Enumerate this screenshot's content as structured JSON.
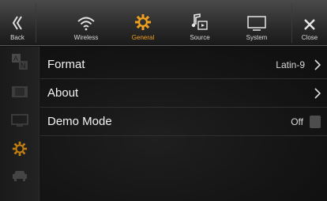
{
  "topbar": {
    "back_label": "Back",
    "close_label": "Close",
    "tabs": [
      {
        "label": "Wireless",
        "icon": "wifi-icon",
        "active": false
      },
      {
        "label": "General",
        "icon": "gear-icon",
        "active": true
      },
      {
        "label": "Source",
        "icon": "music-source-icon",
        "active": false
      },
      {
        "label": "System",
        "icon": "monitor-icon",
        "active": false
      }
    ],
    "accent_color": "#f0a21d"
  },
  "sidebar": {
    "items": [
      {
        "icon": "language-icon"
      },
      {
        "icon": "film-icon"
      },
      {
        "icon": "screen-icon"
      },
      {
        "icon": "gear-icon",
        "active": true
      },
      {
        "icon": "car-icon"
      }
    ]
  },
  "settings": {
    "rows": [
      {
        "title": "Format",
        "value": "Latin-9"
      },
      {
        "title": "About",
        "value": ""
      },
      {
        "title": "Demo Mode",
        "value": "Off"
      }
    ]
  }
}
